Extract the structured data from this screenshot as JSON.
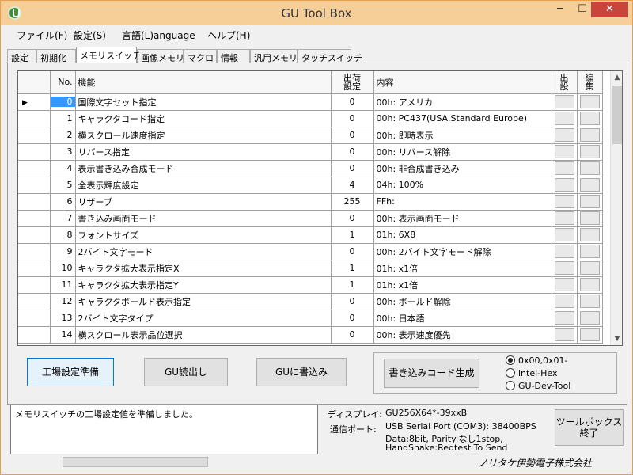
{
  "window": {
    "title": "GU Tool Box",
    "minimize": "─",
    "maximize": "☐",
    "close": "✕"
  },
  "menu": [
    "ファイル(F)",
    "設定(S)",
    "言語(L)anguage",
    "ヘルプ(H)"
  ],
  "tabs": [
    "設定",
    "初期化",
    "メモリスイッチ",
    "画像メモリ",
    "マクロ",
    "情報",
    "汎用メモリ",
    "タッチスイッチ"
  ],
  "grid": {
    "headers": {
      "no": "No.",
      "function": "機能",
      "default_l1": "出荷",
      "default_l2": "設定",
      "content": "内容",
      "out_l1": "出",
      "out_l2": "設",
      "edit_l1": "編",
      "edit_l2": "集"
    },
    "rows": [
      {
        "no": "0",
        "function": "国際文字セット指定",
        "value": "0",
        "content": "00h: アメリカ"
      },
      {
        "no": "1",
        "function": "キャラクタコード指定",
        "value": "0",
        "content": "00h: PC437(USA,Standard Europe)"
      },
      {
        "no": "2",
        "function": "横スクロール速度指定",
        "value": "0",
        "content": "00h: 即時表示"
      },
      {
        "no": "3",
        "function": "リバース指定",
        "value": "0",
        "content": "00h: リバース解除"
      },
      {
        "no": "4",
        "function": "表示書き込み合成モード",
        "value": "0",
        "content": "00h: 非合成書き込み"
      },
      {
        "no": "5",
        "function": "全表示輝度設定",
        "value": "4",
        "content": "04h: 100%"
      },
      {
        "no": "6",
        "function": "リザーブ",
        "value": "255",
        "content": "FFh:"
      },
      {
        "no": "7",
        "function": "書き込み画面モード",
        "value": "0",
        "content": "00h: 表示画面モード"
      },
      {
        "no": "8",
        "function": "フォントサイズ",
        "value": "1",
        "content": "01h: 6X8"
      },
      {
        "no": "9",
        "function": "2バイト文字モード",
        "value": "0",
        "content": "00h: 2バイト文字モード解除"
      },
      {
        "no": "10",
        "function": "キャラクタ拡大表示指定X",
        "value": "1",
        "content": "01h: x1倍"
      },
      {
        "no": "11",
        "function": "キャラクタ拡大表示指定Y",
        "value": "1",
        "content": "01h: x1倍"
      },
      {
        "no": "12",
        "function": "キャラクタボールド表示指定",
        "value": "0",
        "content": "00h: ボールド解除"
      },
      {
        "no": "13",
        "function": "2バイト文字タイプ",
        "value": "0",
        "content": "00h: 日本語"
      },
      {
        "no": "14",
        "function": "横スクロール表示品位選択",
        "value": "0",
        "content": "00h: 表示速度優先"
      }
    ]
  },
  "buttons": {
    "factory_prep": "工場設定準備",
    "gu_read": "GU読出し",
    "gu_write": "GUに書込み",
    "gen_code": "書き込みコード生成",
    "exit_l1": "ツールボックス",
    "exit_l2": "終了"
  },
  "format_options": [
    "0x00,0x01-",
    "intel-Hex",
    "GU-Dev-Tool"
  ],
  "selected_format": "0x00,0x01-",
  "status_message": "メモリスイッチの工場設定値を準備しました。",
  "info": {
    "display_label": "ディスプレイ:",
    "display_value": "GU256X64*-39xxB",
    "port_label": "通信ポート:",
    "port_line1": "USB Serial Port (COM3):  38400BPS",
    "port_line2": "Data:8bit, Parity:なし1stop,",
    "port_line3": "HandShake:Reqtest To Send"
  },
  "company": "ノリタケ伊勢電子株式会社"
}
